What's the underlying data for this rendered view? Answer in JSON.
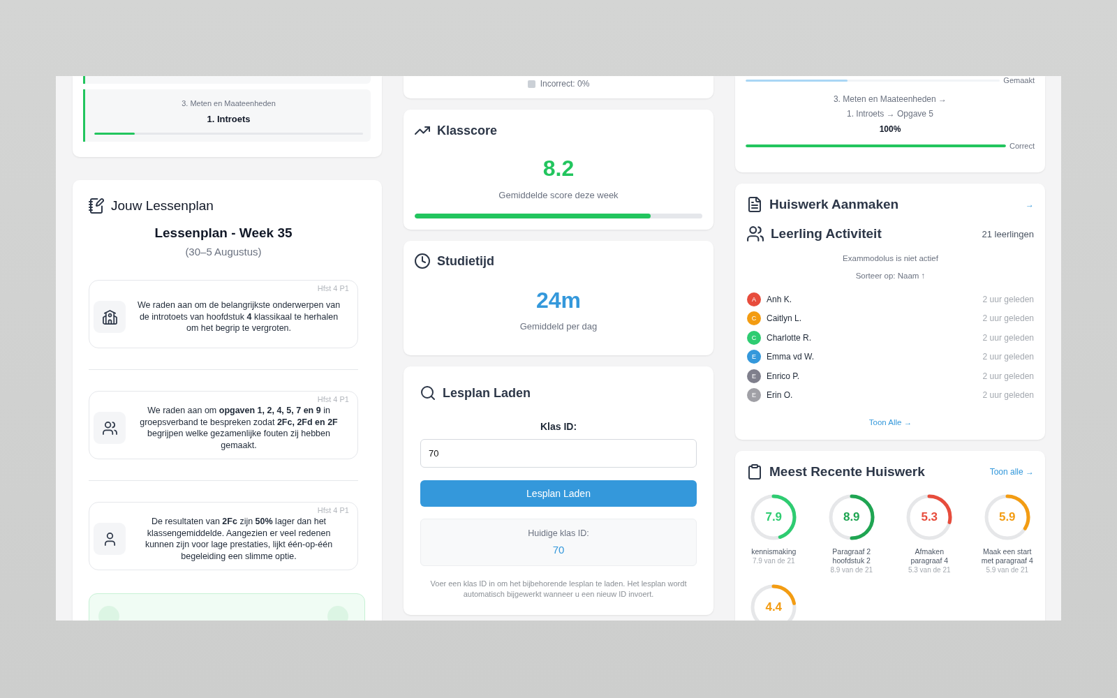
{
  "lesson_progress": {
    "items": [
      {
        "kind": "partial"
      },
      {
        "kind": "full",
        "chapter": "3. Meten en Maateenheden",
        "title": "1. Introets",
        "level": 0.15
      }
    ]
  },
  "lesson_plan": {
    "title": "Jouw Lessenplan",
    "heading": "Lessenplan - Week 35",
    "dates": "(30–5 Augustus)",
    "recommendations": [
      {
        "kind": "school",
        "tag": "Hfst 4 P1",
        "text": "We raden aan om de belangrijkste onderwerpen van de introtoets van hoofdstuk **4** klassikaal te herhalen om het begrip te vergroten."
      },
      {
        "kind": "group",
        "tag": "Hfst 4 P1",
        "text": "We raden aan om **opgaven 1, 2, 4, 5, 7 en 9** in groepsverband te bespreken zodat **2Fc, 2Fd en 2F** begrijpen welke gezamenlijke fouten zij hebben gemaakt."
      },
      {
        "kind": "person",
        "tag": "Hfst 4 P1",
        "text": "De resultaten van **2Fc** zijn **50%** lager dan het klassengemiddelde. Aangezien er veel redenen kunnen zijn voor lage prestaties, lijkt één-op-één begeleiding een slimme optie."
      }
    ]
  },
  "results_legend": [
    {
      "label": "Incorrect: 0%"
    }
  ],
  "class_score": {
    "title": "Klasscore",
    "value": "8.2",
    "caption": "Gemiddelde score deze week",
    "level": 0.82
  },
  "study_time": {
    "title": "Studietijd",
    "value": "24m",
    "caption": "Gemiddeld per dag"
  },
  "load_plan": {
    "title": "Lesplan Laden",
    "field_label": "Klas ID:",
    "value": "70",
    "button": "Lesplan Laden",
    "current_label": "Huidige klas ID:",
    "current_value": "70",
    "note": "Voer een klas ID in om het bijbehorende lesplan te laden. Het lesplan wordt automatisch bijgewerkt wanneer u een nieuw ID invoert."
  },
  "exercise_progress": {
    "top_bar": {
      "label": "Gemaakt",
      "level": 0.4
    },
    "path": [
      "3. Meten en Maateenheden →",
      "1. Introets → Opgave 5"
    ],
    "percent": "100%",
    "result_bar": {
      "label": "Correct",
      "level": 1
    }
  },
  "homework_create": {
    "title": "Huiswerk Aanmaken",
    "link": "→"
  },
  "student_activity": {
    "title": "Leerling Activiteit",
    "count": "21 leerlingen",
    "exam_mode": "Exammodolus is niet actief",
    "sort": "Sorteer op: Naam ↑",
    "students": [
      {
        "initial": "A",
        "name": "Anh K.",
        "time": "2 uur geleden",
        "color": "#e74c3c"
      },
      {
        "initial": "C",
        "name": "Caitlyn L.",
        "time": "2 uur geleden",
        "color": "#f39c12"
      },
      {
        "initial": "C",
        "name": "Charlotte R.",
        "time": "2 uur geleden",
        "color": "#2ecc71"
      },
      {
        "initial": "E",
        "name": "Emma vd W.",
        "time": "2 uur geleden",
        "color": "#3498db"
      },
      {
        "initial": "E",
        "name": "Enrico P.",
        "time": "2 uur geleden",
        "color": "#7f7f8c"
      },
      {
        "initial": "E",
        "name": "Erin O.",
        "time": "2 uur geleden",
        "color": "#a0a0a6"
      }
    ],
    "show_all": "Toon Alle →"
  },
  "recent_homework": {
    "title": "Meest Recente Huiswerk",
    "show_all": "Toon alle →",
    "items": [
      {
        "value": "7.9",
        "title": "kennismaking",
        "detail": "7.9 van de 21",
        "level": 0.45,
        "color": "#2ecc71"
      },
      {
        "value": "8.9",
        "title": "Paragraaf 2 hoofdstuk 2",
        "detail": "8.9 van de 21",
        "level": 0.5,
        "color": "#1fa552"
      },
      {
        "value": "5.3",
        "title": "Afmaken paragraaf 4",
        "detail": "5.3 van de 21",
        "level": 0.29,
        "color": "#e74c3c"
      },
      {
        "value": "5.9",
        "title": "Maak een start met paragraaf 4",
        "detail": "5.9 van de 21",
        "level": 0.34,
        "color": "#f39c12"
      },
      {
        "value": "4.4",
        "level": 0.22,
        "color": "#f39c12"
      }
    ]
  }
}
